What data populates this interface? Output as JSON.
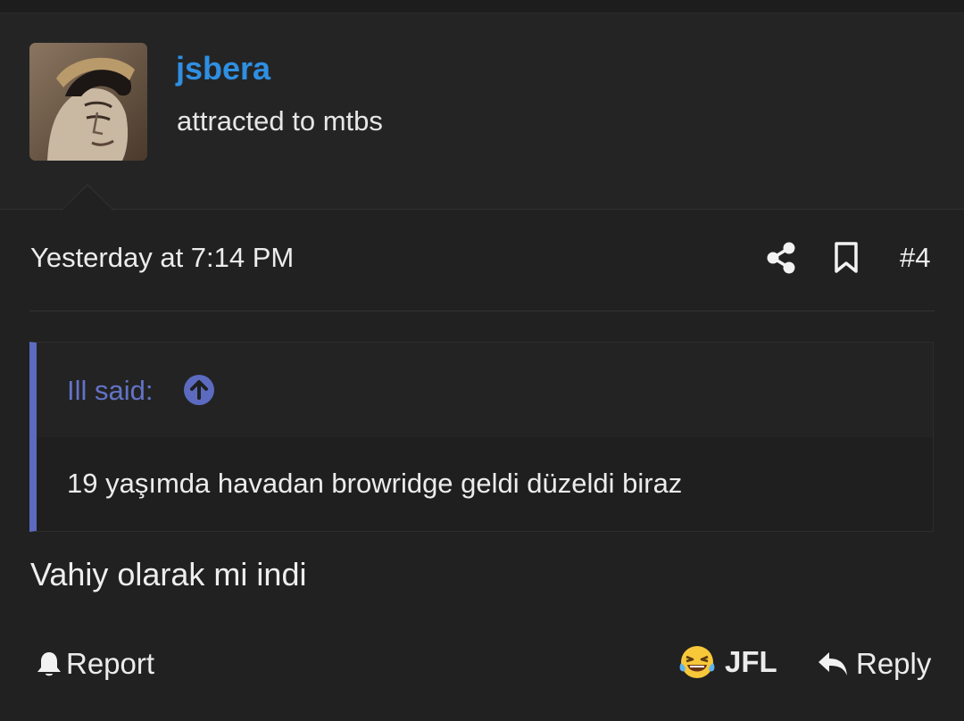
{
  "post": {
    "author": {
      "username": "jsbera",
      "title": "attracted to mtbs"
    },
    "date": "Yesterday at 7:14 PM",
    "number": "#4",
    "quote": {
      "author_line": "Ill said:",
      "text": "19 yaşımda havadan browridge geldi düzeldi biraz"
    },
    "message": "Vahiy olarak mi indi"
  },
  "actions": {
    "report_label": "Report",
    "reaction_label": "JFL",
    "reply_label": "Reply"
  },
  "icons": {
    "share": "share-icon",
    "bookmark": "bookmark-icon",
    "quote_jump": "arrow-up-circle-icon",
    "report": "bell-icon",
    "reaction": "crying-laughing-emoji-icon",
    "reply": "reply-arrow-icon"
  },
  "colors": {
    "background": "#212121",
    "username": "#2f8fe2",
    "quote_accent": "#5c6bc0",
    "quote_author": "#6373c8",
    "text": "#ececec"
  }
}
